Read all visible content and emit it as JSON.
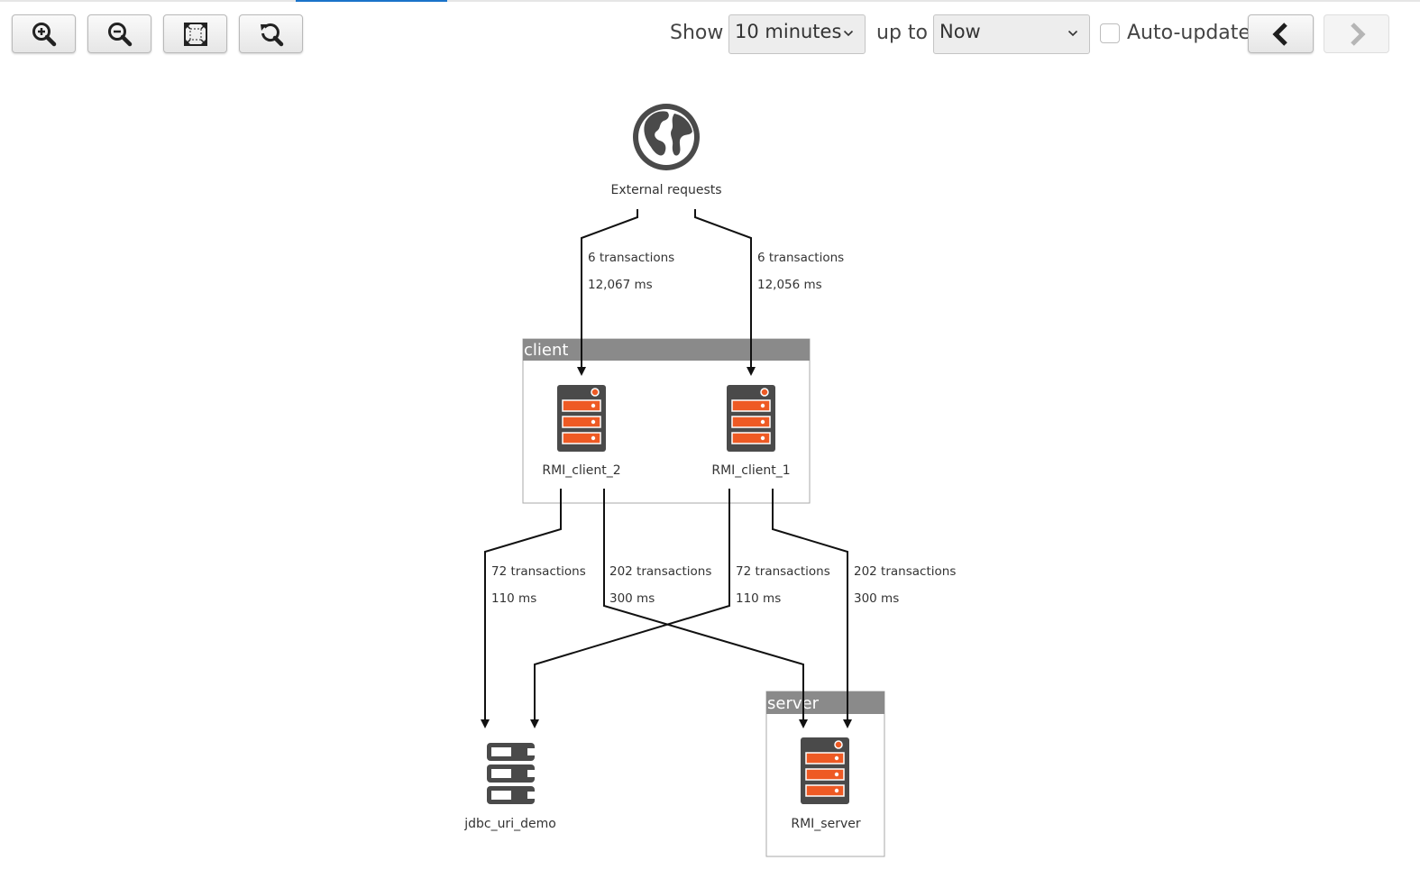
{
  "toolbar": {
    "show_label": "Show",
    "time_range": "10 minutes",
    "upto_label": "up to",
    "upto_value": "Now",
    "autoupdate_label": "Auto-update",
    "autoupdate_checked": false
  },
  "graph": {
    "nodes": {
      "external": "External requests",
      "rmi_client_2": "RMI_client_2",
      "rmi_client_1": "RMI_client_1",
      "jdbc": "jdbc_uri_demo",
      "rmi_server": "RMI_server"
    },
    "groups": {
      "client": "client",
      "server": "server"
    },
    "edges": {
      "ext_to_client2": {
        "count": "6 transactions",
        "time": "12,067 ms"
      },
      "ext_to_client1": {
        "count": "6 transactions",
        "time": "12,056 ms"
      },
      "client2_to_jdbc": {
        "count": "72 transactions",
        "time": "110 ms"
      },
      "client2_to_server": {
        "count": "202 transactions",
        "time": "300 ms"
      },
      "client1_to_jdbc": {
        "count": "72 transactions",
        "time": "110 ms"
      },
      "client1_to_server": {
        "count": "202 transactions",
        "time": "300 ms"
      }
    }
  },
  "colors": {
    "accent": "#ee5a24",
    "icon_dark": "#4a4a4a",
    "group_header": "#8a8a8a"
  }
}
